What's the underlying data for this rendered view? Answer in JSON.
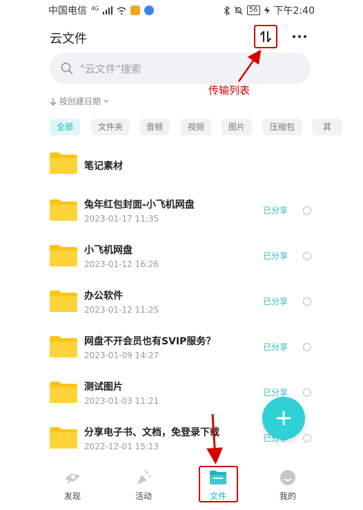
{
  "status_bar": {
    "carrier": "中国电信",
    "network": "4G",
    "battery": "56",
    "time": "下午2:40"
  },
  "header": {
    "title": "云文件",
    "transfer_icon": "up-down-arrows-icon",
    "more_icon": "more-dots-icon"
  },
  "search": {
    "placeholder": "\"云文件\"搜索"
  },
  "annotation": {
    "text": "传输列表"
  },
  "sort": {
    "label": "按创建日期"
  },
  "filters": [
    "全部",
    "文件夹",
    "音频",
    "视频",
    "图片",
    "压缩包",
    "其"
  ],
  "files": [
    {
      "name": "笔记素材",
      "date": "",
      "status": ""
    },
    {
      "name": "兔年红包封面-小飞机网盘",
      "date": "2023-01-17 11:35",
      "status": "已分享"
    },
    {
      "name": "小飞机网盘",
      "date": "2023-01-12 16:26",
      "status": "已分享"
    },
    {
      "name": "办公软件",
      "date": "2023-01-12 11:25",
      "status": "已分享"
    },
    {
      "name": "网盘不开会员也有SVIP服务？",
      "date": "2023-01-09 14:27",
      "status": "已分享"
    },
    {
      "name": "测试图片",
      "date": "2023-01-03 11:21",
      "status": "已分享"
    },
    {
      "name": "分享电子书、文档，免登录下载",
      "date": "2022-12-01 15:13",
      "status": "已分享"
    }
  ],
  "tabs": [
    {
      "label": "发现",
      "icon": "discover-icon"
    },
    {
      "label": "活动",
      "icon": "party-popper-icon"
    },
    {
      "label": "文件",
      "icon": "folder-icon"
    },
    {
      "label": "我的",
      "icon": "profile-face-icon"
    }
  ],
  "colors": {
    "accent": "#19b5bc",
    "fab": "#2fd0d6",
    "folder": "#fcc419",
    "annotation": "#d40000"
  }
}
